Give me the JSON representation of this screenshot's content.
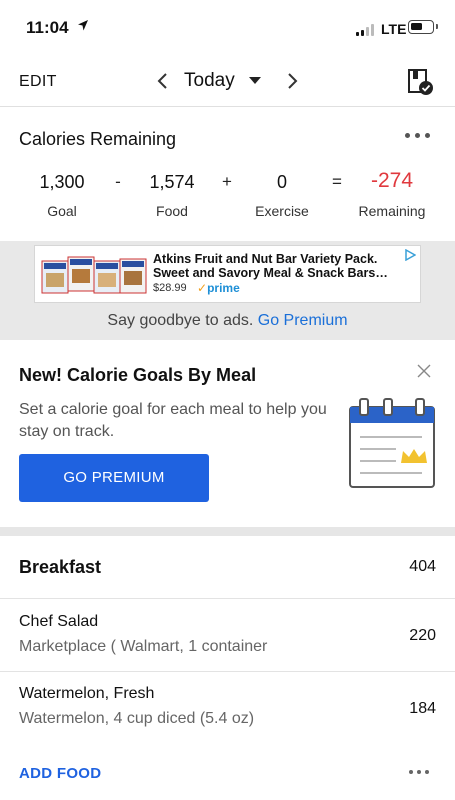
{
  "status_bar": {
    "time": "11:04",
    "network": "LTE"
  },
  "nav": {
    "edit_label": "EDIT",
    "date_label": "Today"
  },
  "calories": {
    "title": "Calories Remaining",
    "goal": {
      "value": "1,300",
      "label": "Goal"
    },
    "food": {
      "value": "1,574",
      "label": "Food"
    },
    "exercise": {
      "value": "0",
      "label": "Exercise"
    },
    "remaining": {
      "value": "-274",
      "label": "Remaining"
    },
    "op_minus": "-",
    "op_plus": "+",
    "op_equals": "="
  },
  "ad": {
    "title": "Atkins Fruit and Nut Bar Variety Pack.",
    "subtitle": "Sweet and Savory Meal & Snack Bars…",
    "price": "$28.99",
    "prime_label": "prime",
    "footer_text": "Say goodbye to ads.",
    "footer_link": "Go Premium"
  },
  "promo": {
    "title": "New! Calorie Goals By Meal",
    "description": "Set a calorie goal for each meal to help you stay on track.",
    "button_label": "GO PREMIUM"
  },
  "meal": {
    "name": "Breakfast",
    "calories": "404",
    "items": [
      {
        "name": "Chef Salad",
        "description": "Marketplace ( Walmart, 1 container",
        "calories": "220"
      },
      {
        "name": "Watermelon, Fresh",
        "description": "Watermelon, 4 cup diced (5.4 oz)",
        "calories": "184"
      }
    ],
    "add_food_label": "ADD FOOD"
  },
  "colors": {
    "accent_blue": "#1f62e0",
    "remaining_red": "#e0393e",
    "ad_background": "#e8e8e8"
  }
}
